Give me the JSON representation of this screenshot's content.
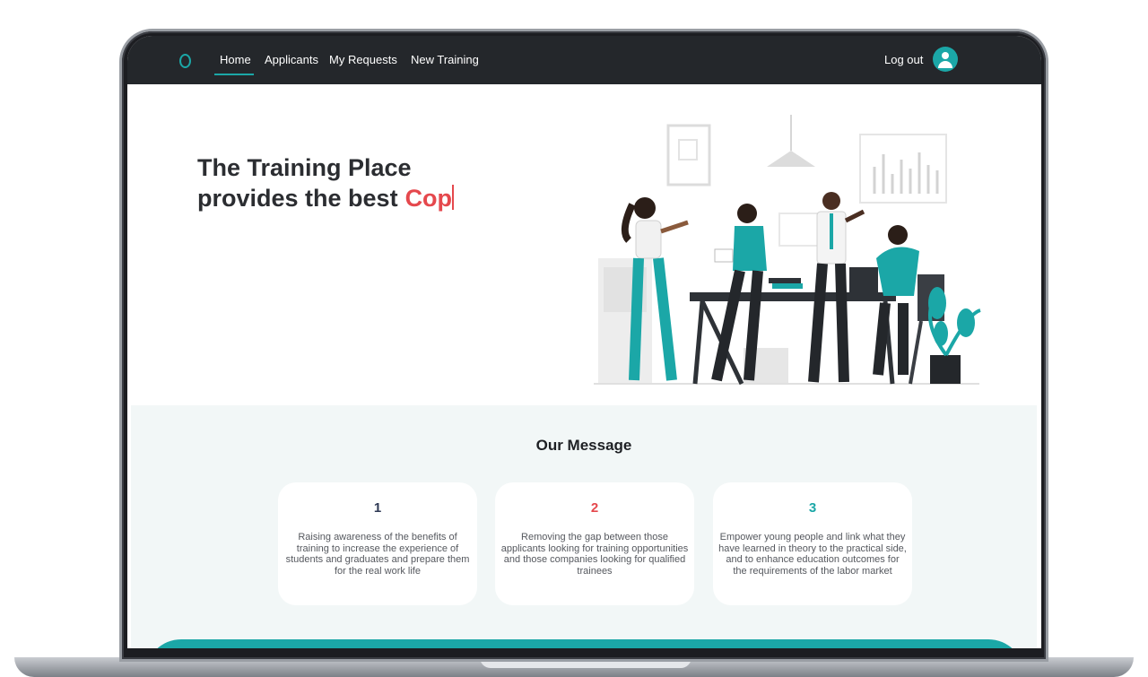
{
  "nav": {
    "links": [
      "Home",
      "Applicants",
      "My Requests",
      "New Training"
    ],
    "logout": "Log out",
    "accent": "#1ba7a7"
  },
  "hero": {
    "line1": "The Training Place",
    "line2": "provides the best",
    "typed": "Cop",
    "typed_color": "#e5484d"
  },
  "message": {
    "title": "Our Message",
    "cards": [
      {
        "num": "1",
        "color": "#2f3a55",
        "text": "Raising awareness of the benefits of training to increase the experience of students and graduates and prepare them for the real work life"
      },
      {
        "num": "2",
        "color": "#e5484d",
        "text": "Removing the gap between those applicants looking for training opportunities and those companies looking for qualified trainees"
      },
      {
        "num": "3",
        "color": "#1ba7a7",
        "text": "Empower young people and link what they have learned in theory to the practical side, and to enhance education outcomes for the requirements of the labor market"
      }
    ]
  },
  "icons": {
    "logo": "ring-logo-icon",
    "avatar": "user-avatar-icon"
  }
}
